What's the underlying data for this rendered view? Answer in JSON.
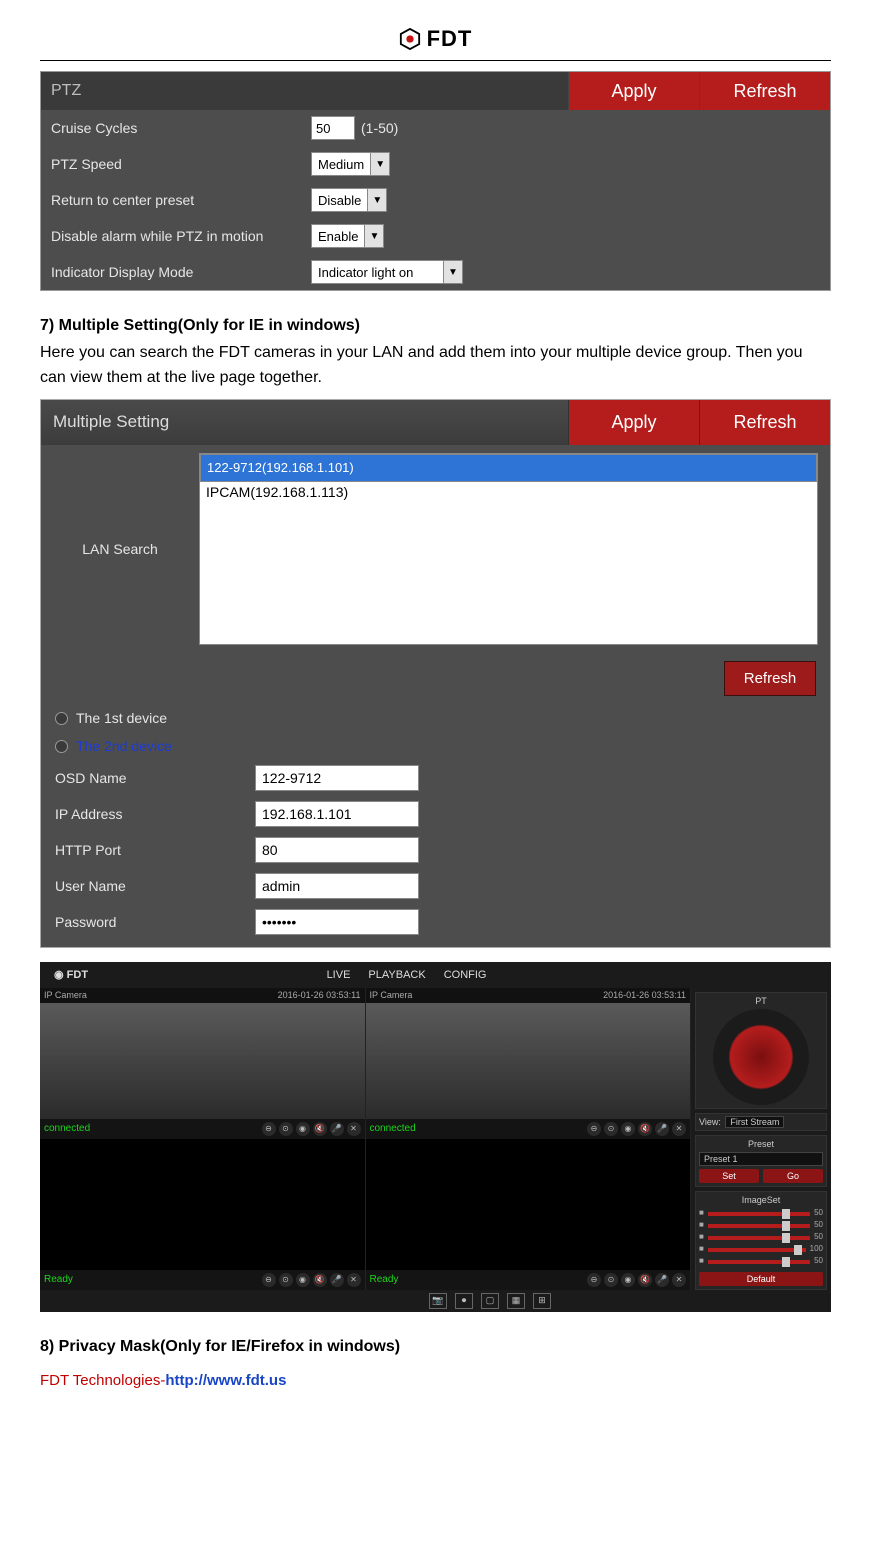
{
  "brand": "FDT",
  "ptz": {
    "title": "PTZ",
    "apply": "Apply",
    "refresh": "Refresh",
    "rows": {
      "cruise_label": "Cruise Cycles",
      "cruise_value": "50",
      "cruise_suffix": "(1-50)",
      "speed_label": "PTZ Speed",
      "speed_value": "Medium",
      "return_label": "Return to center preset",
      "return_value": "Disable",
      "alarm_label": "Disable alarm while PTZ in motion",
      "alarm_value": "Enable",
      "indicator_label": "Indicator Display Mode",
      "indicator_value": "Indicator light on"
    }
  },
  "sec7": {
    "title": "7) Multiple Setting(Only for IE in windows)",
    "body": "Here you can search the FDT cameras in your LAN and add them into your multiple device group. Then you can view them at the live page together."
  },
  "ms": {
    "title": "Multiple Setting",
    "apply": "Apply",
    "refresh": "Refresh",
    "lan_search": "LAN Search",
    "list": [
      "122-9712(192.168.1.101)",
      "IPCAM(192.168.1.113)"
    ],
    "list_refresh": "Refresh",
    "dev1": "The 1st device",
    "dev2": "The 2nd device",
    "osd_label": "OSD Name",
    "osd_value": "122-9712",
    "ip_label": "IP Address",
    "ip_value": "192.168.1.101",
    "port_label": "HTTP Port",
    "port_value": "80",
    "user_label": "User Name",
    "user_value": "admin",
    "pass_label": "Password",
    "pass_value": "•••••••"
  },
  "live": {
    "tabs": [
      "LIVE",
      "PLAYBACK",
      "CONFIG"
    ],
    "cam_label": "IP Camera",
    "timestamp": "2016-01-26 03:53:11",
    "status_connected": "connected",
    "status_ready": "Ready",
    "pt": "PT",
    "view_label": "View:",
    "view_value": "First Stream",
    "preset_title": "Preset",
    "preset_value": "Preset 1",
    "set": "Set",
    "go": "Go",
    "imageset": "ImageSet",
    "slider_vals": [
      "50",
      "50",
      "50",
      "100",
      "50"
    ],
    "default": "Default"
  },
  "sec8": {
    "title": "8) Privacy Mask(Only for IE/Firefox in windows)"
  },
  "footer": {
    "company": "FDT Technologies-",
    "url_prefix": "http://",
    "url_host": "www.fdt.us"
  }
}
